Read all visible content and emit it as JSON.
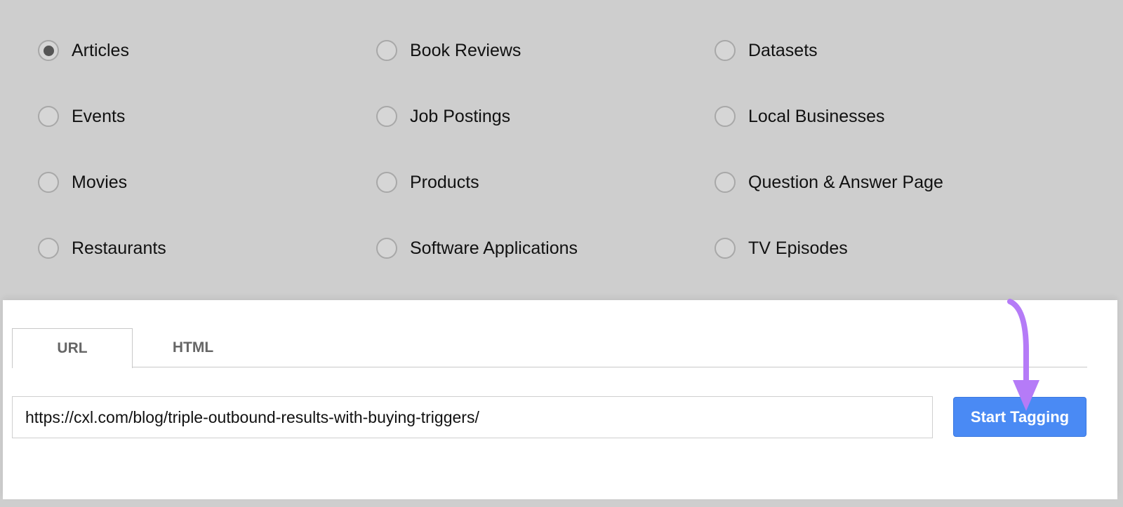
{
  "types": [
    {
      "label": "Articles",
      "selected": true
    },
    {
      "label": "Book Reviews",
      "selected": false
    },
    {
      "label": "Datasets",
      "selected": false
    },
    {
      "label": "Events",
      "selected": false
    },
    {
      "label": "Job Postings",
      "selected": false
    },
    {
      "label": "Local Businesses",
      "selected": false
    },
    {
      "label": "Movies",
      "selected": false
    },
    {
      "label": "Products",
      "selected": false
    },
    {
      "label": "Question & Answer Page",
      "selected": false
    },
    {
      "label": "Restaurants",
      "selected": false
    },
    {
      "label": "Software Applications",
      "selected": false
    },
    {
      "label": "TV Episodes",
      "selected": false
    }
  ],
  "tabs": [
    {
      "label": "URL",
      "active": true
    },
    {
      "label": "HTML",
      "active": false
    }
  ],
  "url_input": {
    "value": "https://cxl.com/blog/triple-outbound-results-with-buying-triggers/"
  },
  "start_button": {
    "label": "Start Tagging"
  },
  "colors": {
    "button": "#4a8af4",
    "arrow": "#b57bf7",
    "background": "#cecece"
  },
  "annotation": {
    "icon": "arrow-down-icon"
  }
}
